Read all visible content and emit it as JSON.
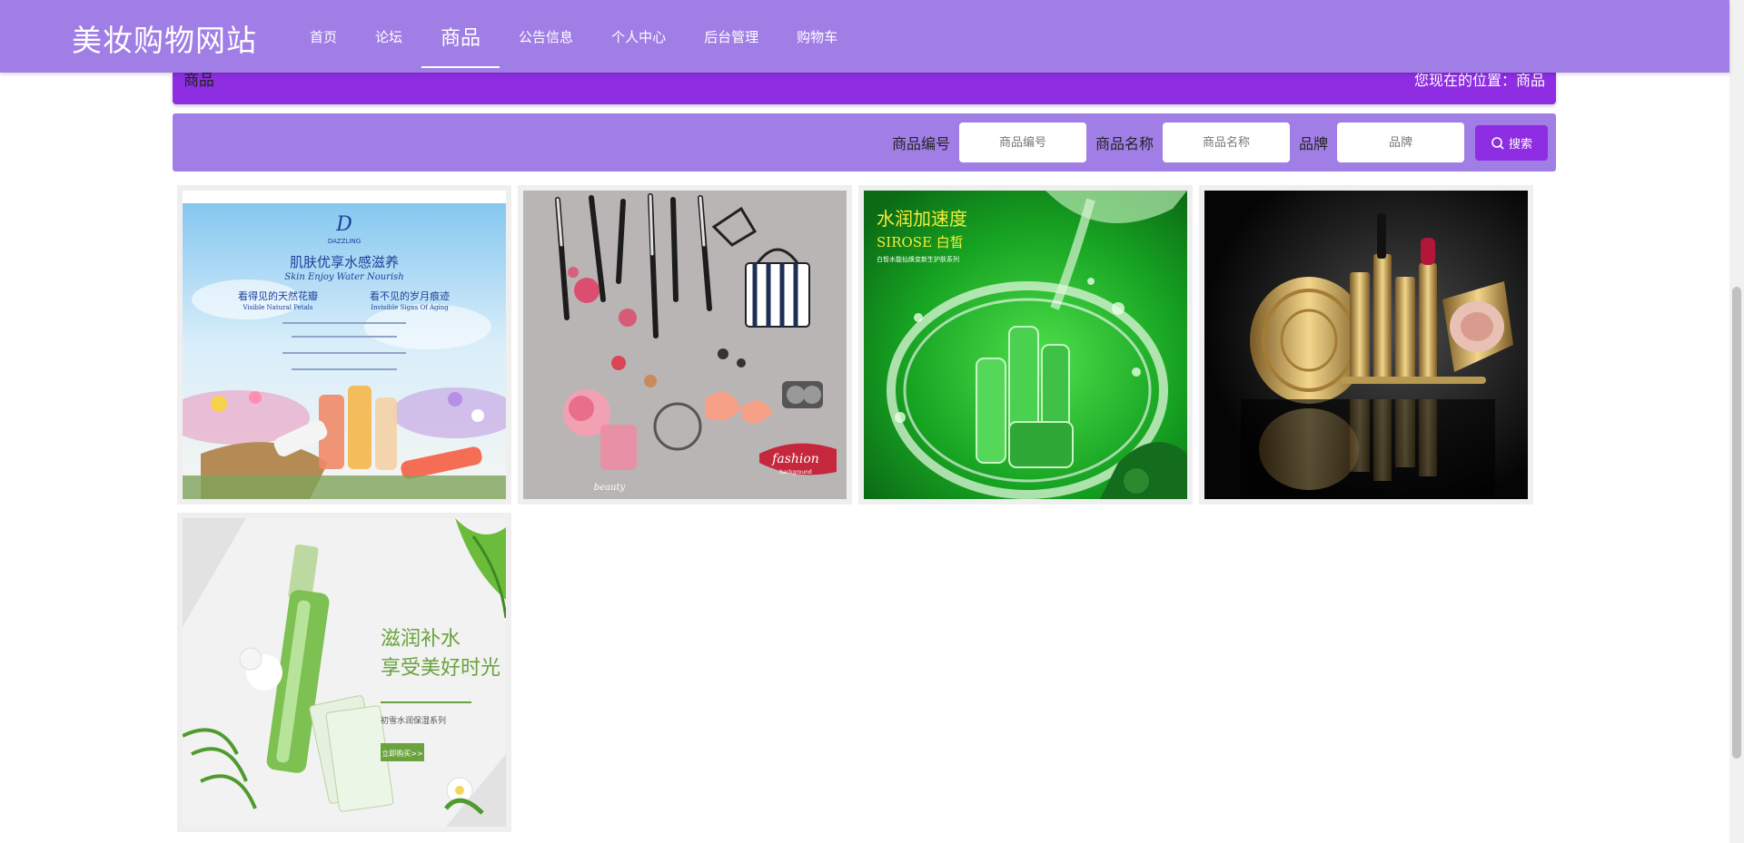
{
  "site": {
    "title": "美妆购物网站"
  },
  "nav": {
    "items": [
      {
        "label": "首页"
      },
      {
        "label": "论坛"
      },
      {
        "label": "商品"
      },
      {
        "label": "公告信息"
      },
      {
        "label": "个人中心"
      },
      {
        "label": "后台管理"
      },
      {
        "label": "购物车"
      }
    ],
    "active_index": 2
  },
  "breadcrumb": {
    "title": "商品",
    "position": "您现在的位置：商品"
  },
  "search": {
    "code_label": "商品编号",
    "code_placeholder": "商品编号",
    "name_label": "商品名称",
    "name_placeholder": "商品名称",
    "brand_label": "品牌",
    "brand_placeholder": "品牌",
    "button_label": "搜索"
  },
  "products": [
    {
      "image_text": {
        "logo": "D",
        "brand": "DAZZLING",
        "headline": "肌肤优享水感滋养",
        "headline_en": "Skin Enjoy Water Nourish",
        "sub_left": "看得见的天然花瓣",
        "sub_right": "看不见的岁月痕迹",
        "sub_left_en": "Visible Natural Petals",
        "sub_right_en": "Invisible Signs Of Aging"
      }
    },
    {
      "image_text": {
        "script": "fashion",
        "script_sub": "background",
        "script2": "beauty"
      }
    },
    {
      "image_text": {
        "title": "水润加速度",
        "brand": "SIROSE 白皙",
        "sub": "白皙水能仙焕变新生护肤系列"
      }
    },
    {
      "image_text": {}
    },
    {
      "image_text": {
        "line1": "滋润补水",
        "line2": "享受美好时光",
        "line3": "初雪水润保湿系列",
        "cta": "立即购买>>"
      }
    }
  ],
  "colors": {
    "nav_bg": "#a17ee6",
    "accent": "#8e2de2"
  }
}
